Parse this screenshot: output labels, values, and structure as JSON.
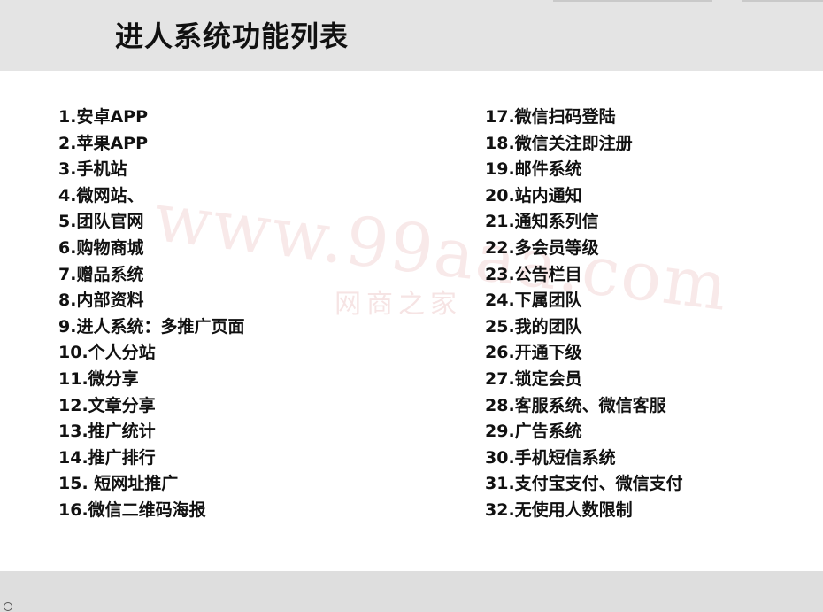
{
  "title": "进人系统功能列表",
  "watermark": {
    "url": "www.99aaa.com",
    "text": "网商之家"
  },
  "features": {
    "left": [
      "1.安卓APP",
      "2.苹果APP",
      "3.手机站",
      "4.微网站、",
      "5.团队官网",
      "6.购物商城",
      "7.赠品系统",
      "8.内部资料",
      "9.进人系统：多推广页面",
      "10.个人分站",
      "11.微分享",
      "12.文章分享",
      "13.推广统计",
      "14.推广排行",
      "15. 短网址推广",
      "16.微信二维码海报"
    ],
    "right": [
      "17.微信扫码登陆",
      "18.微信关注即注册",
      "19.邮件系统",
      "20.站内通知",
      "21.通知系列信",
      "22.多会员等级",
      "23.公告栏目",
      "24.下属团队",
      "25.我的团队",
      "26.开通下级",
      "27.锁定会员",
      "28.客服系统、微信客服",
      "29.广告系统",
      "30.手机短信系统",
      "31.支付宝支付、微信支付",
      "32.无使用人数限制"
    ]
  }
}
